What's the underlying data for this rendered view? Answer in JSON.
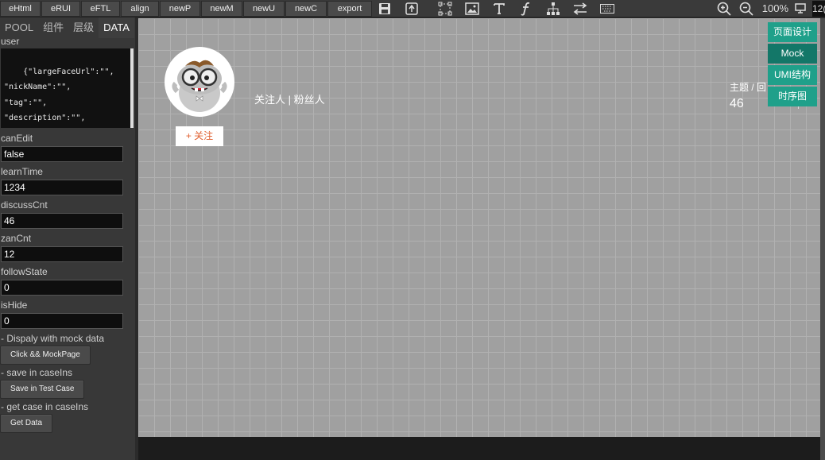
{
  "toolbar": {
    "buttons": [
      "eHtml",
      "eRUI",
      "eFTL",
      "align",
      "newP",
      "newM",
      "newU",
      "newC",
      "export"
    ],
    "icons": [
      "save-icon",
      "upload-icon",
      "select-area-icon",
      "image-icon",
      "text-icon",
      "function-icon",
      "tree-icon",
      "swap-icon",
      "keyboard-icon"
    ],
    "zoom": "100%",
    "clipped_text": "12("
  },
  "left_panel": {
    "tabs": [
      "POOL",
      "组件",
      "层级",
      "DATA"
    ],
    "active_tab": "DATA",
    "user_label": "user",
    "user_json": "{\"largeFaceUrl\":\"\",\n\"nickName\":\"\",\n\"tag\":\"\",\n\"description\":\"\",\n\"followCount\":\"\",",
    "fields": [
      {
        "label": "canEdit",
        "value": "false"
      },
      {
        "label": "learnTime",
        "value": "1234"
      },
      {
        "label": "discussCnt",
        "value": "46"
      },
      {
        "label": "zanCnt",
        "value": "12"
      },
      {
        "label": "followState",
        "value": "0"
      },
      {
        "label": "isHide",
        "value": "0"
      }
    ],
    "mock_section": "- Dispaly with mock data",
    "mock_button": "Click && MockPage",
    "save_section": "- save in caseIns",
    "save_button": "Save in Test Case",
    "get_section": "- get case in caseIns",
    "get_button": "Get Data"
  },
  "canvas": {
    "follow_button": "+ 关注",
    "follow_fans": "关注人 | 粉丝人",
    "topic_label": "主题 / 回",
    "topic_count": "46"
  },
  "side_menu": [
    "页面设计",
    "Mock",
    "UMI结构",
    "时序图"
  ],
  "colors": {
    "accent": "#1fa08a",
    "accent_dark": "#137768",
    "follow_text": "#e06030"
  }
}
